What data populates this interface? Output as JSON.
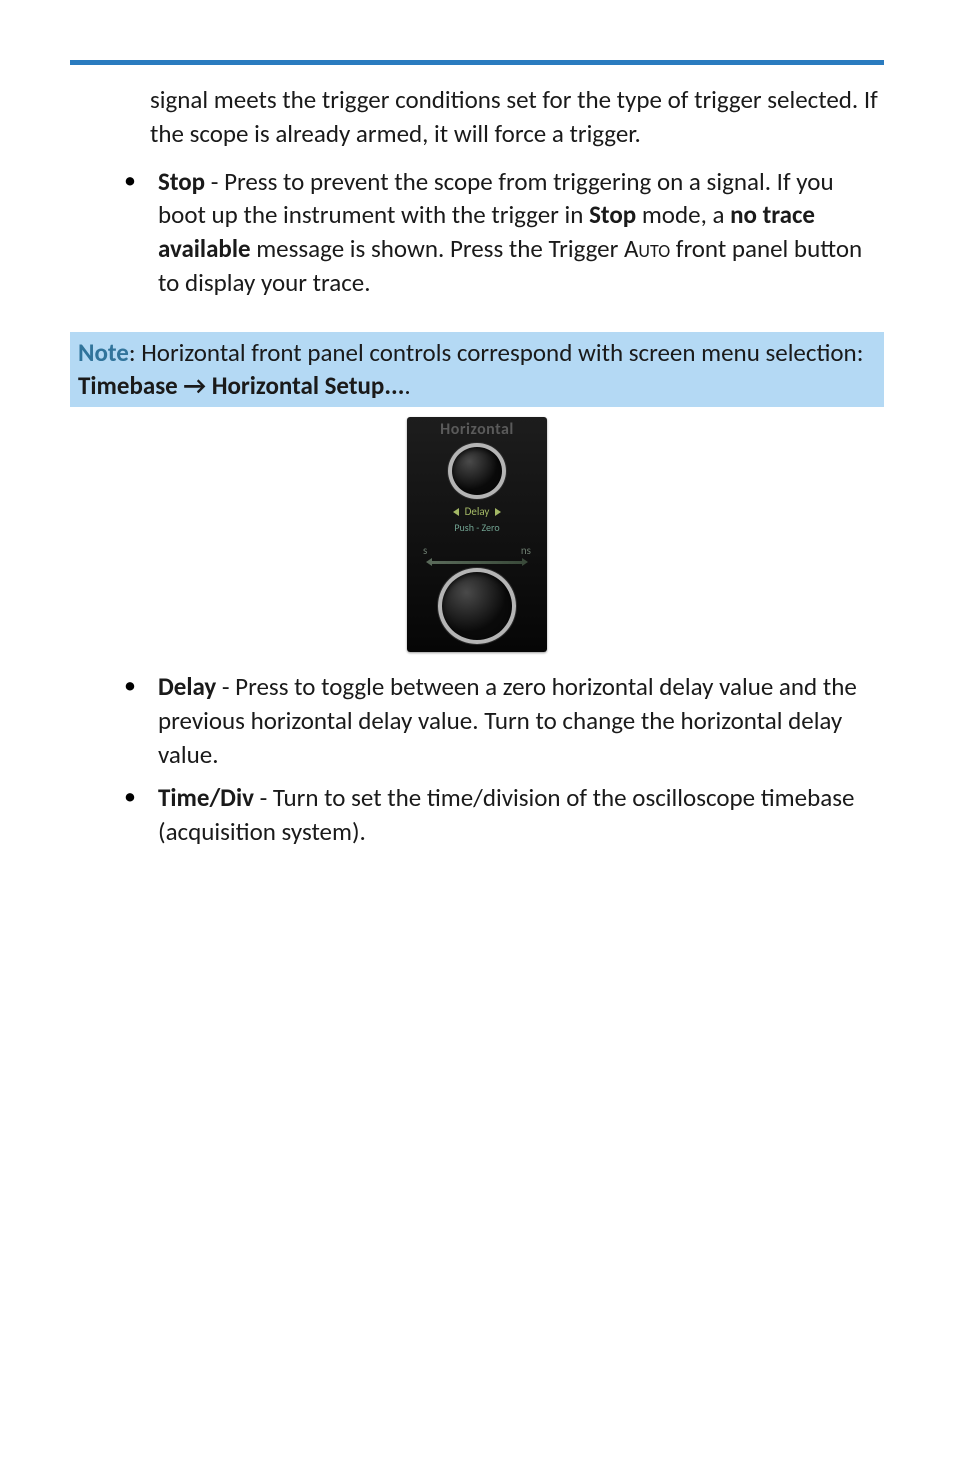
{
  "continuation": "signal meets the trigger conditions set for the type of trigger selected. If the scope is already armed, it will force a trigger.",
  "stop": {
    "label": "Stop",
    "text1": " - Press to prevent the scope from triggering on a signal. If you boot up the instrument with the trigger in ",
    "mode": "Stop",
    "text2": " mode, a ",
    "msg": "no trace available",
    "text3": " message is shown. Press the Trigger ",
    "btn": "Auto",
    "text4": " front panel button to display your trace."
  },
  "note": {
    "prefix": "Note",
    "body": ": Horizontal front panel controls correspond with screen menu selection: ",
    "menu": "Timebase → Horizontal Setup...",
    "period": "."
  },
  "panel": {
    "title": "Horizontal",
    "delay": "Delay",
    "push": "Push - Zero",
    "s": "s",
    "ns": "ns"
  },
  "delay": {
    "label": "Delay",
    "text": " - Press to toggle between a zero horizontal delay value and the previous horizontal delay value. Turn to change the horizontal delay value."
  },
  "timediv": {
    "label": "Time/Div",
    "text": " - Turn to set the time/division of the oscilloscope timebase (acquisition system)."
  }
}
